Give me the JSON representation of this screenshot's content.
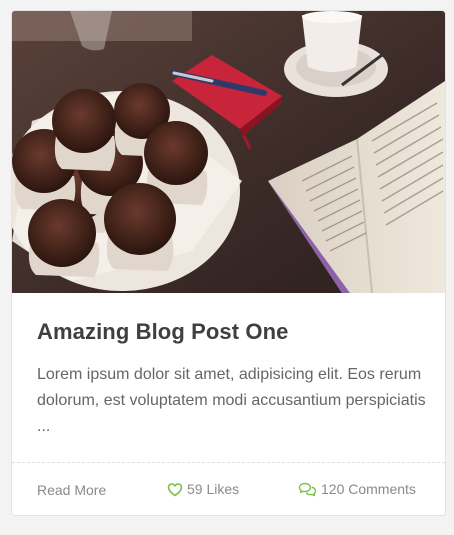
{
  "post": {
    "title": "Amazing Blog Post One",
    "excerpt": "Lorem ipsum dolor sit amet, adipisicing elit. Eos rerum dolorum, est voluptatem modi accusantium perspiciatis ...",
    "read_more_label": "Read More",
    "likes_label": "59 Likes",
    "comments_label": "120 Comments",
    "image_subject": "muffins, coffee cup, notebook, pen and open book on table"
  },
  "icons": {
    "likes": "heart-icon",
    "comments": "comments-icon"
  },
  "colors": {
    "accent": "#7cbf4a",
    "title": "#3f3f3f",
    "text": "#666666",
    "muted": "#8a8a8a"
  }
}
